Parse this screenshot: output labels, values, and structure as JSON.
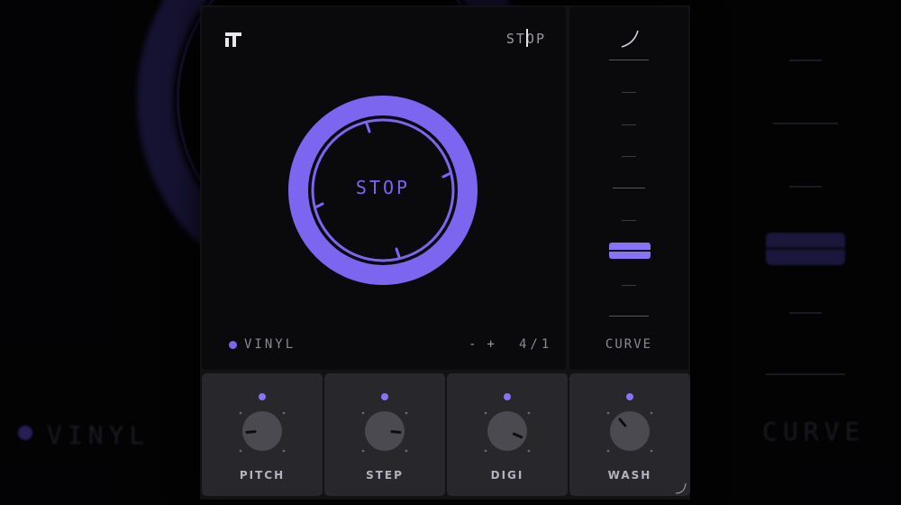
{
  "background": {
    "echo_mode": "VINYL",
    "echo_curve": "CURVE"
  },
  "header": {
    "mode_readout": "STOP",
    "logo_icon": "tr-logo-icon"
  },
  "dial": {
    "label": "STOP",
    "accent": "#7c66f0"
  },
  "mode": {
    "label": "VINYL"
  },
  "controls": {
    "minus": "-",
    "plus": "+",
    "ratio": "4/1"
  },
  "side": {
    "curve_icon": "curve-icon",
    "label": "CURVE",
    "fader_level": 0.26
  },
  "knobs": [
    {
      "name": "PITCH",
      "value": 0.15
    },
    {
      "name": "STEP",
      "value": 0.85
    },
    {
      "name": "DIGI",
      "value": 0.92
    },
    {
      "name": "WASH",
      "value": 0.35
    }
  ],
  "colors": {
    "accent": "#8872f5",
    "panel": "#0a0a0c",
    "knob_cell": "#28282c"
  }
}
